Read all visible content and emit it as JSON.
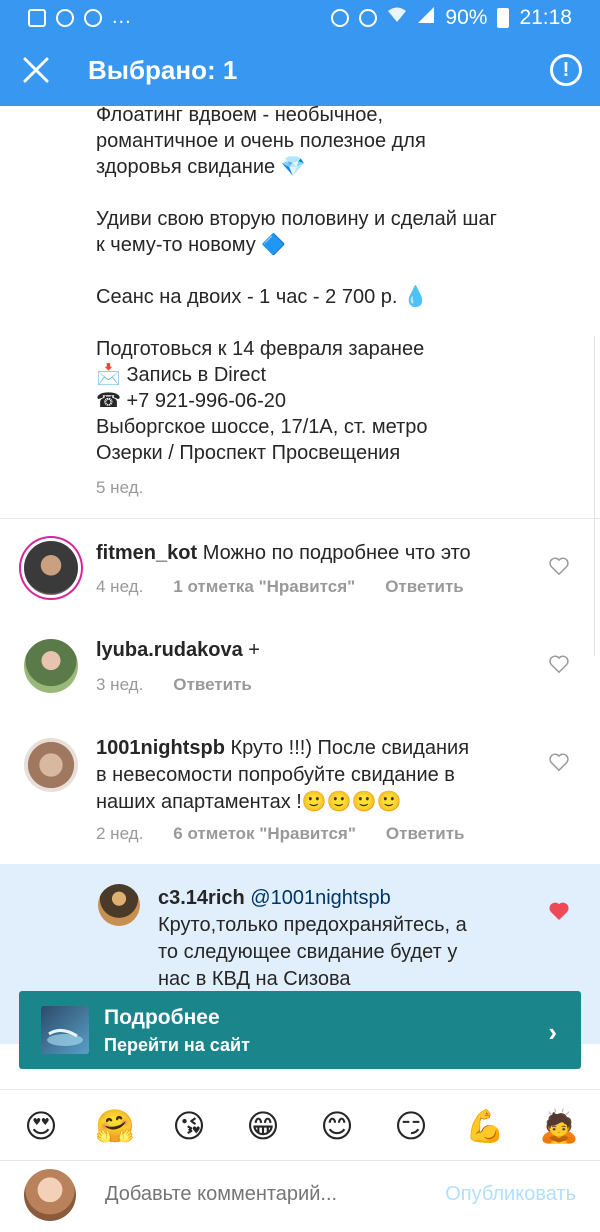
{
  "status_bar": {
    "dots": "...",
    "battery": "90%",
    "time": "21:18"
  },
  "appbar": {
    "title": "Выбрано: 1"
  },
  "caption": {
    "text": "Флоатинг вдвоем - необычное,\nромантичное и очень полезное для\nздоровья свидание 💎\n\nУдиви свою вторую половину и сделай шаг\nк чему-то новому 🔷\n\nСеанс на двоих - 1 час - 2 700 р. 💧\n\nПодготовься к 14 февраля заранее\n📩 Запись в Direct\n☎ +7 921-996-06-20\nВыборгское шоссе, 17/1А, ст. метро\nОзерки / Проспект Просвещения",
    "time": "5 нед."
  },
  "comments": [
    {
      "username": "fitmen_kot",
      "text": "Можно по подробнее что это",
      "time": "4 нед.",
      "likes": "1 отметка \"Нравится\"",
      "reply": "Ответить"
    },
    {
      "username": "lyuba.rudakova",
      "text": "+",
      "time": "3 нед.",
      "reply": "Ответить"
    },
    {
      "username": "1001nightspb",
      "text": "Круто !!!) После свидания\nв невесомости попробуйте свидание в\nнаших апартаментах !🙂🙂🙂🙂",
      "time": "2 нед.",
      "likes": "6 отметок \"Нравится\"",
      "reply": "Ответить"
    },
    {
      "username": "c3.14rich",
      "mention": "@1001nightspb",
      "text": "Круто,только предохраняйтесь, а\nто следующее свидание будет у\nнас в КВД на Сизова"
    }
  ],
  "cta": {
    "title": "Подробнее",
    "subtitle": "Перейти на сайт"
  },
  "emojis": [
    "😍",
    "🤗",
    "😘",
    "😁",
    "😊",
    "😏",
    "💪",
    "🙇"
  ],
  "input": {
    "placeholder": "Добавьте комментарий...",
    "post_label": "Опубликовать"
  },
  "colors": {
    "accent": "#3897f0",
    "cta": "#1b858c",
    "liked_heart": "#ed4956",
    "reply_highlight": "#e1effd"
  }
}
